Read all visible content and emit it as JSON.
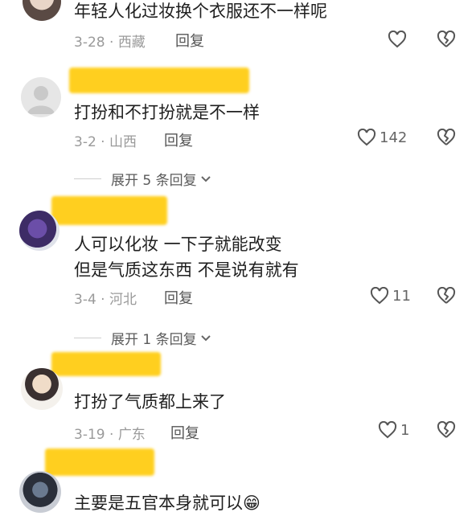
{
  "comments": [
    {
      "text": "年轻人化过妆换个衣服还不一样呢",
      "date": "3-28",
      "location": "西藏",
      "reply": "回复",
      "likes": ""
    },
    {
      "text": "打扮和不打扮就是不一样",
      "date": "3-2",
      "location": "山西",
      "reply": "回复",
      "likes": "142"
    },
    {
      "text_line1": "人可以化妆  一下子就能改变",
      "text_line2": "但是气质这东西 不是说有就有",
      "date": "3-4",
      "location": "河北",
      "reply": "回复",
      "likes": "11"
    },
    {
      "text": "打扮了气质都上来了",
      "date": "3-19",
      "location": "广东",
      "reply": "回复",
      "likes": "1"
    },
    {
      "text": "主要是五官本身就可以",
      "emoji": "😁"
    }
  ],
  "expand": [
    {
      "label": "展开 5 条回复"
    },
    {
      "label": "展开 1 条回复"
    }
  ],
  "colors": {
    "highlight": "#ffcf1f",
    "meta": "#9a9a9a"
  }
}
